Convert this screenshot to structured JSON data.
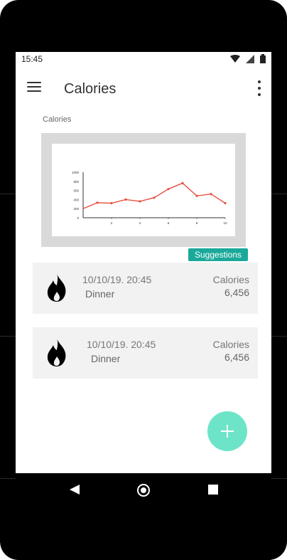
{
  "status_bar": {
    "time": "15:45",
    "icons": [
      "wifi-icon",
      "signal-icon",
      "battery-icon"
    ]
  },
  "app_bar": {
    "title": "Calories",
    "menu_icon": "hamburger-menu-icon",
    "more_icon": "more-vert-icon"
  },
  "chart_section": {
    "label": "Calories"
  },
  "chart_data": {
    "type": "line",
    "x": [
      1,
      2,
      3,
      4,
      5,
      6,
      7,
      8,
      9,
      10
    ],
    "values": [
      200,
      330,
      320,
      400,
      360,
      440,
      630,
      760,
      480,
      520,
      320
    ],
    "x_points": [
      1,
      2,
      3,
      4,
      5,
      6,
      7,
      8,
      9,
      10
    ],
    "y_ticks": [
      "0",
      "200",
      "400",
      "600",
      "800",
      "1000"
    ],
    "x_ticks": [
      "2",
      "4",
      "6",
      "8",
      "10"
    ],
    "xlim": [
      0,
      10
    ],
    "ylim": [
      0,
      1000
    ],
    "series_color": "#e8513f"
  },
  "suggestions_button": {
    "label": "Suggestions"
  },
  "entries": [
    {
      "date": "10/10/19. 20:45",
      "meal": "Dinner",
      "cal_label": "Calories",
      "cal_value": "6,456"
    },
    {
      "date": "10/10/19.  20:45",
      "meal": "Dinner",
      "cal_label": "Calories",
      "cal_value": "6,456"
    }
  ],
  "fab": {
    "icon": "plus-icon",
    "color": "#6de4c7"
  },
  "nav_bar": {
    "back": "back-icon",
    "home": "home-icon",
    "recents": "recents-icon"
  }
}
